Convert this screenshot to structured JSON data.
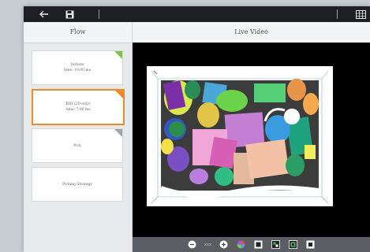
{
  "left_panel": {
    "title": "Flow",
    "cards": [
      {
        "title": "Initiate",
        "subtitle": "time: 10.00 ms",
        "corner": "#7cc24a"
      },
      {
        "title": "ROI (2D only)",
        "subtitle": "time: 7.00 ms",
        "corner": "#f08a24"
      },
      {
        "title": "Pick",
        "subtitle": "",
        "corner": "#a0a4a8"
      },
      {
        "title": "Picking Strategy",
        "subtitle": "",
        "corner": ""
      }
    ]
  },
  "right_panel": {
    "title": "Live Video"
  },
  "controls": {
    "zoom_text": "xxx"
  },
  "icons": {
    "back": "arrow-left-icon",
    "save": "save-icon",
    "grid": "grid-icon",
    "zoom_out": "zoom-out-icon",
    "zoom_in": "zoom-in-icon",
    "color": "color-wheel-icon",
    "view1": "view-mode-icon",
    "view2": "camera-icon",
    "view3": "layers-icon",
    "view4": "fullscreen-icon"
  },
  "colors": {
    "active": "#f08a24",
    "topbar": "#1d1f22"
  }
}
